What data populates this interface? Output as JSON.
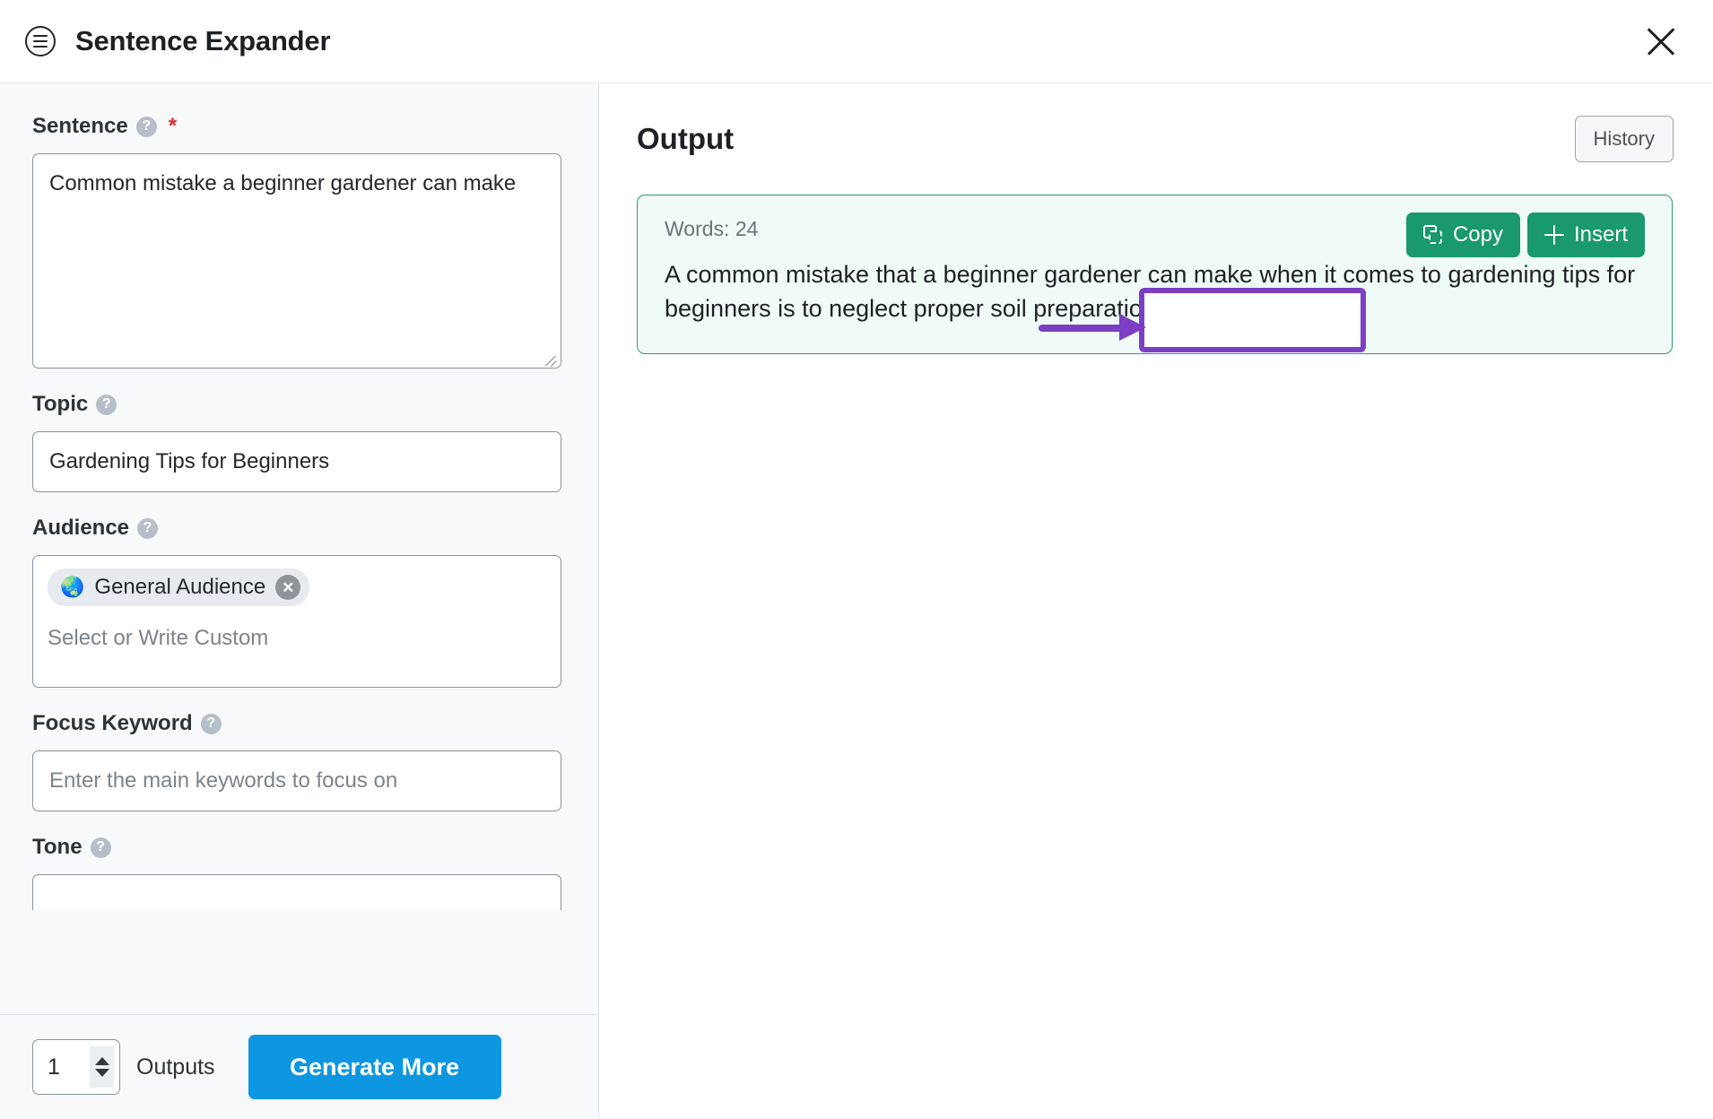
{
  "header": {
    "menu_icon": "hamburger-circle-icon",
    "title": "Sentence Expander",
    "close_icon": "close-icon"
  },
  "form": {
    "sentence": {
      "label": "Sentence",
      "help_icon": "question-mark-icon",
      "required_marker": "*",
      "value": "Common mistake a beginner gardener can make"
    },
    "topic": {
      "label": "Topic",
      "help_icon": "question-mark-icon",
      "value": "Gardening Tips for Beginners"
    },
    "audience": {
      "label": "Audience",
      "help_icon": "question-mark-icon",
      "chip_emoji": "🌏",
      "chip_label": "General Audience",
      "chip_remove_icon": "remove-chip-icon",
      "placeholder": "Select or Write Custom"
    },
    "focus_keyword": {
      "label": "Focus Keyword",
      "help_icon": "question-mark-icon",
      "placeholder": "Enter the main keywords to focus on",
      "value": ""
    },
    "tone": {
      "label": "Tone",
      "help_icon": "question-mark-icon"
    }
  },
  "footer": {
    "outputs_count": "1",
    "outputs_label": "Outputs",
    "generate_label": "Generate More",
    "generate_color": "#0c97e0"
  },
  "output": {
    "title": "Output",
    "history_label": "History",
    "card": {
      "words_label": "Words: 24",
      "text": "A common mistake that a beginner gardener can make when it comes to gardening tips for beginners is to neglect proper soil preparation.",
      "border_color": "#2a9d7f",
      "background_color": "#f0faf6",
      "copy_label": "Copy",
      "insert_label": "Insert",
      "action_color": "#19996d"
    }
  },
  "annotation": {
    "color": "#7c3fc4",
    "shape": "rectangle-highlight-with-arrow"
  }
}
